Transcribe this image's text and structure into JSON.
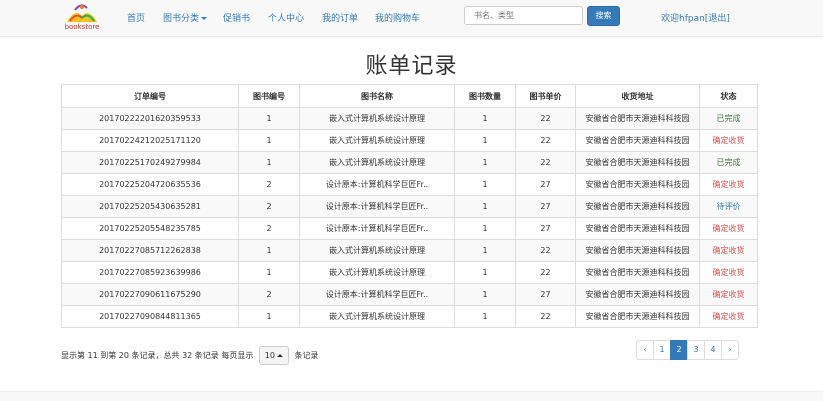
{
  "brand": {
    "logo_text": "bookstore"
  },
  "nav": {
    "home": "首页",
    "category": "图书分类",
    "promo": "促销书",
    "user_center": "个人中心",
    "my_orders": "我的订单",
    "my_cart": "我的购物车"
  },
  "search": {
    "placeholder": "书名、类型",
    "button": "搜索"
  },
  "welcome": "欢迎hfpan[退出]",
  "page_title": "账单记录",
  "table": {
    "headers": [
      "订单编号",
      "图书编号",
      "图书名称",
      "图书数量",
      "图书单价",
      "收货地址",
      "状态"
    ],
    "rows": [
      [
        "20170222201620359533",
        "1",
        "嵌入式计算机系统设计原理",
        "1",
        "22",
        "安徽省合肥市天源迪科科技园",
        "已完成"
      ],
      [
        "20170224212025171120",
        "1",
        "嵌入式计算机系统设计原理",
        "1",
        "22",
        "安徽省合肥市天源迪科科技园",
        "确定收货"
      ],
      [
        "20170225170249279984",
        "1",
        "嵌入式计算机系统设计原理",
        "1",
        "22",
        "安徽省合肥市天源迪科科技园",
        "已完成"
      ],
      [
        "20170225204720635536",
        "2",
        "设计原本:计算机科学巨匠Fr..",
        "1",
        "27",
        "安徽省合肥市天源迪科科技园",
        "确定收货"
      ],
      [
        "20170225205430635281",
        "2",
        "设计原本:计算机科学巨匠Fr..",
        "1",
        "27",
        "安徽省合肥市天源迪科科技园",
        "待评价"
      ],
      [
        "20170225205548235785",
        "2",
        "设计原本:计算机科学巨匠Fr..",
        "1",
        "27",
        "安徽省合肥市天源迪科科技园",
        "确定收货"
      ],
      [
        "20170227085712262838",
        "1",
        "嵌入式计算机系统设计原理",
        "1",
        "22",
        "安徽省合肥市天源迪科科技园",
        "确定收货"
      ],
      [
        "20170227085923639986",
        "1",
        "嵌入式计算机系统设计原理",
        "1",
        "22",
        "安徽省合肥市天源迪科科技园",
        "确定收货"
      ],
      [
        "20170227090611675290",
        "2",
        "设计原本:计算机科学巨匠Fr..",
        "1",
        "27",
        "安徽省合肥市天源迪科科技园",
        "确定收货"
      ],
      [
        "20170227090844811365",
        "1",
        "嵌入式计算机系统设计原理",
        "1",
        "22",
        "安徽省合肥市天源迪科科技园",
        "确定收货"
      ]
    ]
  },
  "pager": {
    "info_prefix": "显示第 11 到第 20 条记录，总共 32 条记录 每页显示",
    "per_page": "10",
    "info_suffix": "条记录",
    "prev": "‹",
    "pages": [
      "1",
      "2",
      "3",
      "4"
    ],
    "active_page": "2",
    "next": "›"
  },
  "status_colors": {
    "已完成": "#3c763d",
    "确定收货": "#d9534f",
    "待评价": "#337ab7"
  }
}
